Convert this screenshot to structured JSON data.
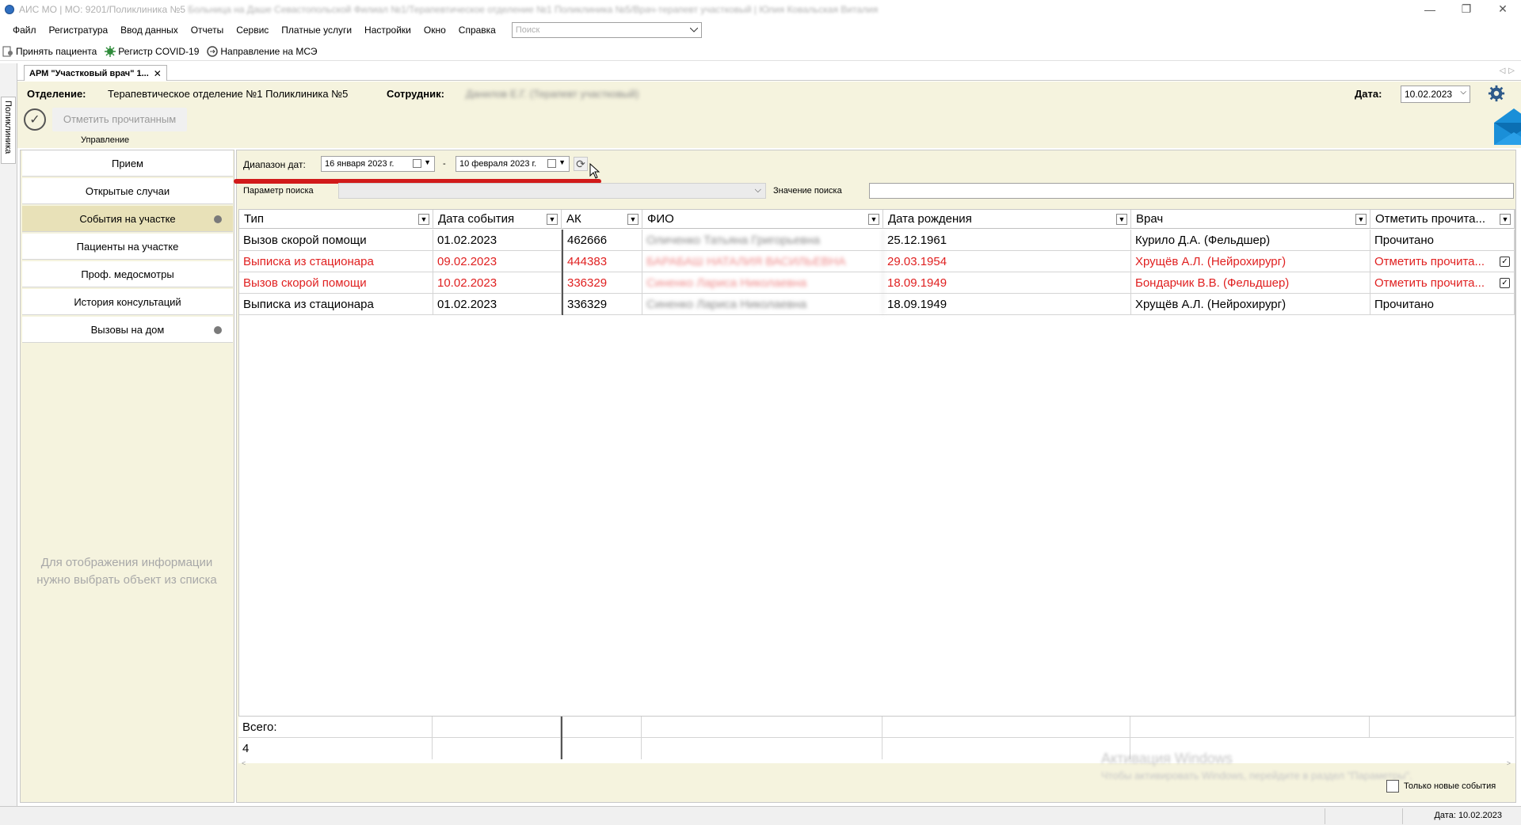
{
  "window": {
    "title_visible": "АИС МО | МО: 9201/Поликлиника №5",
    "title_blurred": " Больница на Даше Севастопольской Филиал №1/Терапевтическое отделение №1 Поликлиника №5/Врач-терапевт участковый | Юлия Ковальская Виталия",
    "controls": {
      "minimize": "—",
      "maximize": "❐",
      "close": "✕"
    }
  },
  "menu": {
    "items": [
      "Файл",
      "Регистратура",
      "Ввод данных",
      "Отчеты",
      "Сервис",
      "Платные услуги",
      "Настройки",
      "Окно",
      "Справка"
    ],
    "search_placeholder": "Поиск"
  },
  "toolbar": {
    "buttons": [
      {
        "label": "Принять пациента",
        "icon": "patient-icon"
      },
      {
        "label": "Регистр COVID-19",
        "icon": "virus-icon"
      },
      {
        "label": "Направление на МСЭ",
        "icon": "referral-icon"
      }
    ]
  },
  "left_strip": {
    "vertical_tab": "Поликлиника"
  },
  "doc_tab": {
    "label": "АРМ \"Участковый врач\" 1...",
    "close": "✕"
  },
  "header": {
    "department_label": "Отделение:",
    "department_value": "Терапевтическое отделение №1 Поликлиника №5",
    "employee_label": "Сотрудник:",
    "employee_value": "Данилов Е.Г. (Терапевт участковый)",
    "date_label": "Дата:",
    "date_value": "10.02.2023",
    "mark_read_label": "Отметить прочитанным",
    "management_label": "Управление"
  },
  "nav": {
    "items": [
      {
        "label": "Прием",
        "dot": false
      },
      {
        "label": "Открытые случаи",
        "dot": false
      },
      {
        "label": "События на участке",
        "dot": true,
        "selected": true
      },
      {
        "label": "Пациенты на участке",
        "dot": false
      },
      {
        "label": "Проф. медосмотры",
        "dot": false
      },
      {
        "label": "История консультаций",
        "dot": false
      },
      {
        "label": "Вызовы на дом",
        "dot": true
      }
    ],
    "empty_text_line1": "Для отображения информации",
    "empty_text_line2": "нужно выбрать объект из списка"
  },
  "filters": {
    "date_range_label": "Диапазон дат:",
    "date_from": "16  января   2023 г.",
    "dash": "-",
    "date_to": "10 февраля  2023 г.",
    "search_param_label": "Параметр поиска",
    "search_value_label": "Значение поиска"
  },
  "grid": {
    "columns": [
      "Тип",
      "Дата события",
      "АК",
      "ФИО",
      "Дата рождения",
      "Врач",
      "Отметить  прочита..."
    ],
    "rows": [
      {
        "type": "Вызов скорой помощи",
        "date": "01.02.2023",
        "ak": "462666",
        "fio": "Оличенко Татьяна Григорьевна",
        "birth": "25.12.1961",
        "doctor": "Курило Д.А. (Фельдшер)",
        "mark": "Прочитано",
        "highlight": false,
        "checkbox": false
      },
      {
        "type": "Выписка из стационара",
        "date": "09.02.2023",
        "ak": "444383",
        "fio": "БАРАБАШ НАТАЛИЯ ВАСИЛЬЕВНА",
        "birth": "29.03.1954",
        "doctor": "Хрущёв А.Л. (Нейрохирург)",
        "mark": "Отметить  прочита...",
        "highlight": true,
        "checkbox": true
      },
      {
        "type": "Вызов скорой помощи",
        "date": "10.02.2023",
        "ak": "336329",
        "fio": "Синенко Лариса Николаевна",
        "birth": "18.09.1949",
        "doctor": "Бондарчик В.В. (Фельдшер)",
        "mark": "Отметить  прочита...",
        "highlight": true,
        "checkbox": true
      },
      {
        "type": "Выписка из стационара",
        "date": "01.02.2023",
        "ak": "336329",
        "fio": "Синенко Лариса Николаевна",
        "birth": "18.09.1949",
        "doctor": "Хрущёв А.Л. (Нейрохирург)",
        "mark": "Прочитано",
        "highlight": false,
        "checkbox": false
      }
    ],
    "total_label": "Всего:",
    "total_value": "4"
  },
  "watermark": {
    "line1": "Активация Windows",
    "line2": "Чтобы активировать Windows, перейдите в раздел \"Параметры\"."
  },
  "only_new_label": "Только новые события",
  "status": {
    "date": "Дата: 10.02.2023"
  },
  "colors": {
    "accent_red": "#e02020",
    "panel_bg": "#f5f3de",
    "selected_nav": "#e8e1b8"
  }
}
